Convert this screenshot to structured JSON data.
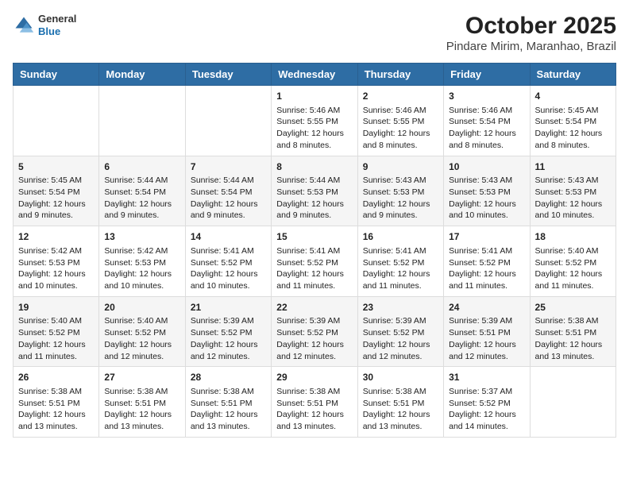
{
  "header": {
    "logo_general": "General",
    "logo_blue": "Blue",
    "title": "October 2025",
    "subtitle": "Pindare Mirim, Maranhao, Brazil"
  },
  "calendar": {
    "headers": [
      "Sunday",
      "Monday",
      "Tuesday",
      "Wednesday",
      "Thursday",
      "Friday",
      "Saturday"
    ],
    "weeks": [
      [
        {
          "day": "",
          "info": ""
        },
        {
          "day": "",
          "info": ""
        },
        {
          "day": "",
          "info": ""
        },
        {
          "day": "1",
          "info": "Sunrise: 5:46 AM\nSunset: 5:55 PM\nDaylight: 12 hours\nand 8 minutes."
        },
        {
          "day": "2",
          "info": "Sunrise: 5:46 AM\nSunset: 5:55 PM\nDaylight: 12 hours\nand 8 minutes."
        },
        {
          "day": "3",
          "info": "Sunrise: 5:46 AM\nSunset: 5:54 PM\nDaylight: 12 hours\nand 8 minutes."
        },
        {
          "day": "4",
          "info": "Sunrise: 5:45 AM\nSunset: 5:54 PM\nDaylight: 12 hours\nand 8 minutes."
        }
      ],
      [
        {
          "day": "5",
          "info": "Sunrise: 5:45 AM\nSunset: 5:54 PM\nDaylight: 12 hours\nand 9 minutes."
        },
        {
          "day": "6",
          "info": "Sunrise: 5:44 AM\nSunset: 5:54 PM\nDaylight: 12 hours\nand 9 minutes."
        },
        {
          "day": "7",
          "info": "Sunrise: 5:44 AM\nSunset: 5:54 PM\nDaylight: 12 hours\nand 9 minutes."
        },
        {
          "day": "8",
          "info": "Sunrise: 5:44 AM\nSunset: 5:53 PM\nDaylight: 12 hours\nand 9 minutes."
        },
        {
          "day": "9",
          "info": "Sunrise: 5:43 AM\nSunset: 5:53 PM\nDaylight: 12 hours\nand 9 minutes."
        },
        {
          "day": "10",
          "info": "Sunrise: 5:43 AM\nSunset: 5:53 PM\nDaylight: 12 hours\nand 10 minutes."
        },
        {
          "day": "11",
          "info": "Sunrise: 5:43 AM\nSunset: 5:53 PM\nDaylight: 12 hours\nand 10 minutes."
        }
      ],
      [
        {
          "day": "12",
          "info": "Sunrise: 5:42 AM\nSunset: 5:53 PM\nDaylight: 12 hours\nand 10 minutes."
        },
        {
          "day": "13",
          "info": "Sunrise: 5:42 AM\nSunset: 5:53 PM\nDaylight: 12 hours\nand 10 minutes."
        },
        {
          "day": "14",
          "info": "Sunrise: 5:41 AM\nSunset: 5:52 PM\nDaylight: 12 hours\nand 10 minutes."
        },
        {
          "day": "15",
          "info": "Sunrise: 5:41 AM\nSunset: 5:52 PM\nDaylight: 12 hours\nand 11 minutes."
        },
        {
          "day": "16",
          "info": "Sunrise: 5:41 AM\nSunset: 5:52 PM\nDaylight: 12 hours\nand 11 minutes."
        },
        {
          "day": "17",
          "info": "Sunrise: 5:41 AM\nSunset: 5:52 PM\nDaylight: 12 hours\nand 11 minutes."
        },
        {
          "day": "18",
          "info": "Sunrise: 5:40 AM\nSunset: 5:52 PM\nDaylight: 12 hours\nand 11 minutes."
        }
      ],
      [
        {
          "day": "19",
          "info": "Sunrise: 5:40 AM\nSunset: 5:52 PM\nDaylight: 12 hours\nand 11 minutes."
        },
        {
          "day": "20",
          "info": "Sunrise: 5:40 AM\nSunset: 5:52 PM\nDaylight: 12 hours\nand 12 minutes."
        },
        {
          "day": "21",
          "info": "Sunrise: 5:39 AM\nSunset: 5:52 PM\nDaylight: 12 hours\nand 12 minutes."
        },
        {
          "day": "22",
          "info": "Sunrise: 5:39 AM\nSunset: 5:52 PM\nDaylight: 12 hours\nand 12 minutes."
        },
        {
          "day": "23",
          "info": "Sunrise: 5:39 AM\nSunset: 5:52 PM\nDaylight: 12 hours\nand 12 minutes."
        },
        {
          "day": "24",
          "info": "Sunrise: 5:39 AM\nSunset: 5:51 PM\nDaylight: 12 hours\nand 12 minutes."
        },
        {
          "day": "25",
          "info": "Sunrise: 5:38 AM\nSunset: 5:51 PM\nDaylight: 12 hours\nand 13 minutes."
        }
      ],
      [
        {
          "day": "26",
          "info": "Sunrise: 5:38 AM\nSunset: 5:51 PM\nDaylight: 12 hours\nand 13 minutes."
        },
        {
          "day": "27",
          "info": "Sunrise: 5:38 AM\nSunset: 5:51 PM\nDaylight: 12 hours\nand 13 minutes."
        },
        {
          "day": "28",
          "info": "Sunrise: 5:38 AM\nSunset: 5:51 PM\nDaylight: 12 hours\nand 13 minutes."
        },
        {
          "day": "29",
          "info": "Sunrise: 5:38 AM\nSunset: 5:51 PM\nDaylight: 12 hours\nand 13 minutes."
        },
        {
          "day": "30",
          "info": "Sunrise: 5:38 AM\nSunset: 5:51 PM\nDaylight: 12 hours\nand 13 minutes."
        },
        {
          "day": "31",
          "info": "Sunrise: 5:37 AM\nSunset: 5:52 PM\nDaylight: 12 hours\nand 14 minutes."
        },
        {
          "day": "",
          "info": ""
        }
      ]
    ]
  }
}
